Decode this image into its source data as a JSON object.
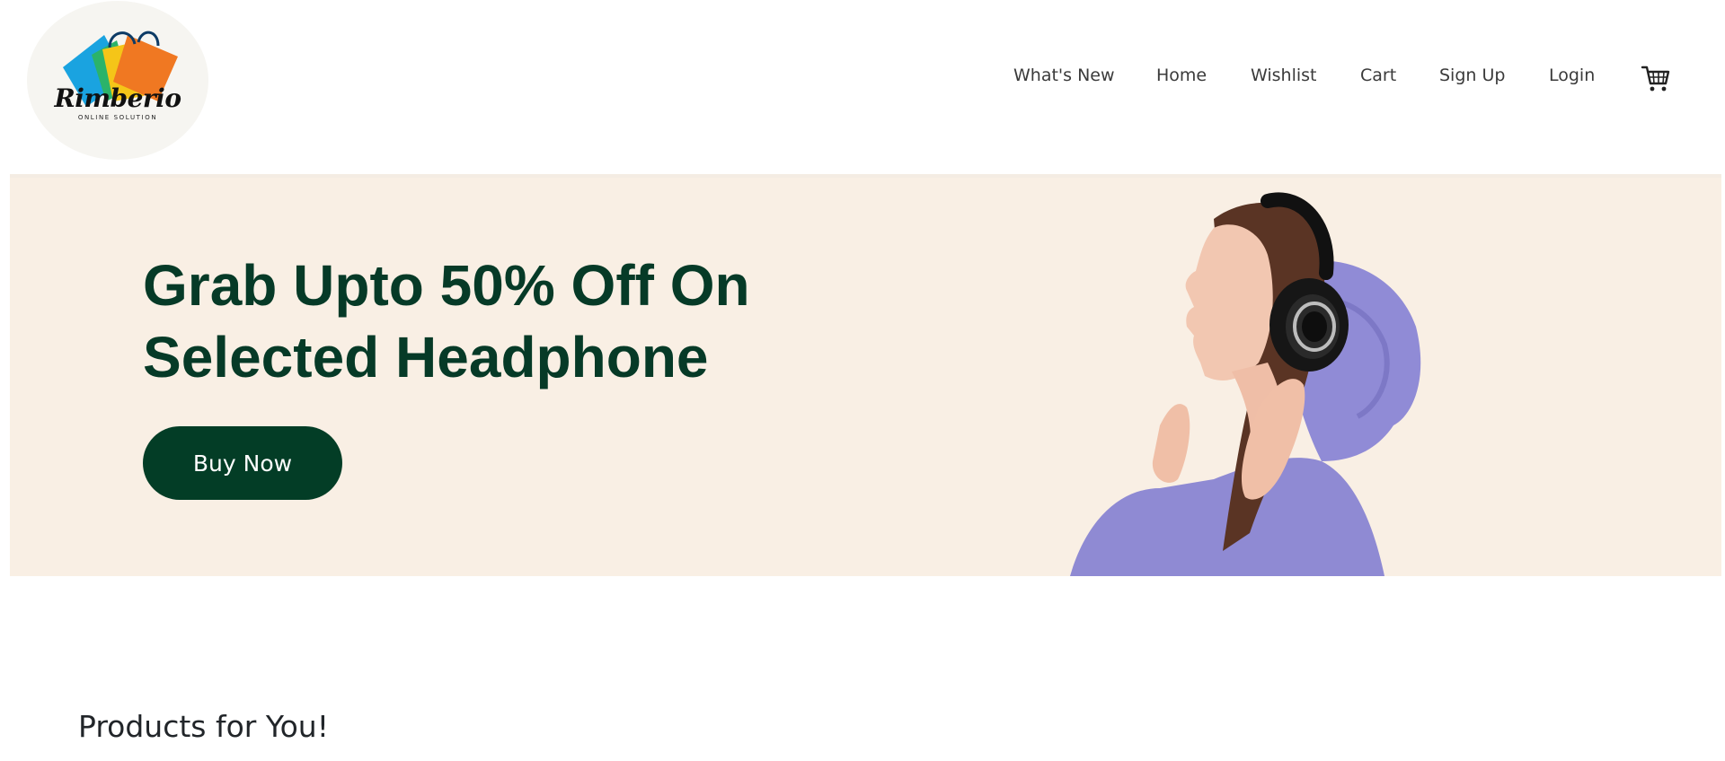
{
  "brand": {
    "name": "Rimberio",
    "tagline": "ONLINE SOLUTION"
  },
  "nav": {
    "items": [
      {
        "label": "What's New"
      },
      {
        "label": "Home"
      },
      {
        "label": "Wishlist"
      },
      {
        "label": "Cart"
      },
      {
        "label": "Sign Up"
      },
      {
        "label": "Login"
      }
    ],
    "cart_icon": "shopping-cart-icon"
  },
  "banner": {
    "title_line1": "Grab Upto 50% Off On",
    "title_line2": "Selected Headphone",
    "button_label": "Buy Now",
    "image": "woman-wearing-headphones-photo"
  },
  "products": {
    "heading": "Products for You!"
  },
  "colors": {
    "banner_bg": "#f9efe4",
    "brand_green": "#063a27",
    "button_bg": "#033d26",
    "hoodie_purple": "#8f8ad3"
  }
}
